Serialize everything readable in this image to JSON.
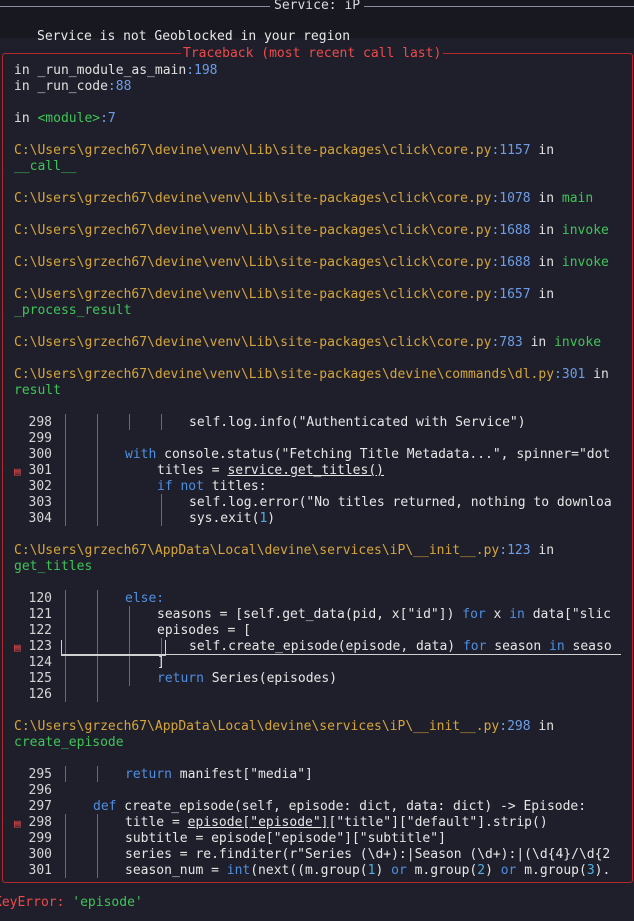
{
  "header": {
    "title": "Service: iP"
  },
  "message": "Service is not Geoblocked in your region",
  "traceback_label": "Traceback (most recent call last)",
  "frames_top": [
    {
      "file": "in _run_module_as_main",
      "line": ":198"
    },
    {
      "file": "in _run_code",
      "line": ":88"
    },
    {
      "file": "in ",
      "module": "<module>",
      "line": ":7"
    }
  ],
  "click_frames": [
    {
      "path": "C:\\Users\\grzech67\\devine\\venv\\Lib\\site-packages\\click\\core.py",
      "lineno": ":1157",
      "in": " in",
      "func": "__call__"
    },
    {
      "path": "C:\\Users\\grzech67\\devine\\venv\\Lib\\site-packages\\click\\core.py",
      "lineno": ":1078",
      "in": " in ",
      "func": "main"
    },
    {
      "path": "C:\\Users\\grzech67\\devine\\venv\\Lib\\site-packages\\click\\core.py",
      "lineno": ":1688",
      "in": " in ",
      "func": "invoke"
    },
    {
      "path": "C:\\Users\\grzech67\\devine\\venv\\Lib\\site-packages\\click\\core.py",
      "lineno": ":1688",
      "in": " in ",
      "func": "invoke"
    },
    {
      "path": "C:\\Users\\grzech67\\devine\\venv\\Lib\\site-packages\\click\\core.py",
      "lineno": ":1657",
      "in": " in",
      "func": "_process_result"
    },
    {
      "path": "C:\\Users\\grzech67\\devine\\venv\\Lib\\site-packages\\click\\core.py",
      "lineno": ":783",
      "in": " in ",
      "func": "invoke"
    },
    {
      "path": "C:\\Users\\grzech67\\devine\\venv\\Lib\\site-packages\\devine\\commands\\dl.py",
      "lineno": ":301",
      "in": " in",
      "func": "result"
    }
  ],
  "block1": {
    "lines": [
      "298",
      "299",
      "300",
      "301",
      "302",
      "303",
      "304"
    ],
    "code": {
      "l298": "self.log.info(\"Authenticated with Service\")",
      "l300_kw": "with",
      "l300_rest": " console.status(\"Fetching Title Metadata...\", spinner=\"dot",
      "l301_a": "titles = ",
      "l301_b": "service.get_titles()",
      "l302_kw1": "if",
      "l302_kw2": "not",
      "l302_rest": " titles:",
      "l303": "self.log.error(\"No titles returned, nothing to downloa",
      "l304_a": "sys.exit(",
      "l304_num": "1",
      "l304_b": ")"
    }
  },
  "frame2": {
    "path": "C:\\Users\\grzech67\\AppData\\Local\\devine\\services\\iP\\__init__.py",
    "lineno": ":123",
    "in": " in",
    "func": "get_titles"
  },
  "block2": {
    "lines": [
      "120",
      "121",
      "122",
      "123",
      "124",
      "125",
      "126"
    ],
    "code": {
      "l120_kw": "else:",
      "l121_a": "seasons = [self.get_data(pid, x[\"id\"]) ",
      "l121_for": "for",
      "l121_b": " x ",
      "l121_in": "in",
      "l121_c": " data[\"slic",
      "l122": "episodes = [",
      "l123_a": "self.create_episode(episode, data) ",
      "l123_for": "for",
      "l123_b": " season ",
      "l123_in": "in",
      "l123_c": " seaso",
      "l124": "]",
      "l125_kw": "return",
      "l125_rest": " Series(episodes)"
    }
  },
  "frame3": {
    "path": "C:\\Users\\grzech67\\AppData\\Local\\devine\\services\\iP\\__init__.py",
    "lineno": ":298",
    "in": " in",
    "func": "create_episode"
  },
  "block3": {
    "lines": [
      "295",
      "296",
      "297",
      "298",
      "299",
      "300",
      "301"
    ],
    "code": {
      "l295_kw": "return",
      "l295_rest": " manifest[\"media\"]",
      "l297_kw": "def",
      "l297_rest": " create_episode(self, episode: dict, data: dict) -> Episode:",
      "l298_a": "title = ",
      "l298_b": "episode[\"episode\"]",
      "l298_c": "[\"title\"][\"default\"].strip()",
      "l299": "subtitle = episode[\"episode\"][\"subtitle\"]",
      "l300": "series = re.finditer(r\"Series (\\d+):|Season (\\d+):|(\\d{4}/\\d{2",
      "l301_a": "season_num = ",
      "l301_int": "int",
      "l301_b": "(next((m.group(",
      "l301_n1": "1",
      "l301_c": ") ",
      "l301_or": "or",
      "l301_d": " m.group(",
      "l301_n2": "2",
      "l301_e": ") ",
      "l301_or2": "or",
      "l301_f": " m.group(",
      "l301_n3": "3",
      "l301_g": ")."
    }
  },
  "error": {
    "name": "KeyError:",
    "value": " 'episode'"
  },
  "colors": {
    "error_red": "#ef4a4a",
    "path_yellow": "#d6a53a",
    "lineno_blue": "#6d9de6",
    "func_green": "#3fc457"
  },
  "icons": {
    "error_marker": "error-marker-icon"
  }
}
